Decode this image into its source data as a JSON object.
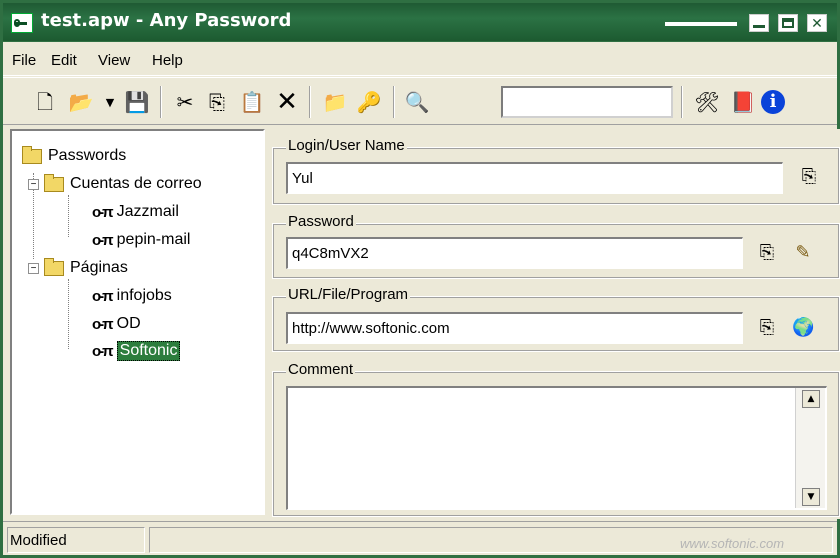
{
  "window": {
    "title": "test.apw - Any Password",
    "controls": [
      "minimize-icon",
      "maximize-icon",
      "close-icon"
    ]
  },
  "menu": [
    "File",
    "Edit",
    "View",
    "Help"
  ],
  "toolbar": {
    "icons": [
      "new-icon",
      "open-icon",
      "dropdown-icon",
      "save-icon",
      "cut-icon",
      "copy-icon",
      "paste-icon",
      "delete-icon",
      "new-folder-icon",
      "new-key-icon",
      "find-icon",
      "tools-icon",
      "help-book-icon",
      "info-icon"
    ],
    "search_value": ""
  },
  "tree": {
    "root": "Passwords",
    "groups": [
      {
        "label": "Cuentas de correo",
        "entries": [
          "Jazzmail",
          "pepin-mail"
        ]
      },
      {
        "label": "Páginas",
        "entries": [
          "infojobs",
          "OD",
          "Softonic"
        ]
      }
    ],
    "selected": "Softonic"
  },
  "details": {
    "login": {
      "label": "Login/User Name",
      "value": "Yul"
    },
    "password": {
      "label": "Password",
      "value": "q4C8mVX2"
    },
    "url": {
      "label": "URL/File/Program",
      "value": "http://www.softonic.com"
    },
    "comment": {
      "label": "Comment",
      "value": ""
    }
  },
  "status": {
    "text": "Modified"
  },
  "watermark": "www.softonic.com"
}
